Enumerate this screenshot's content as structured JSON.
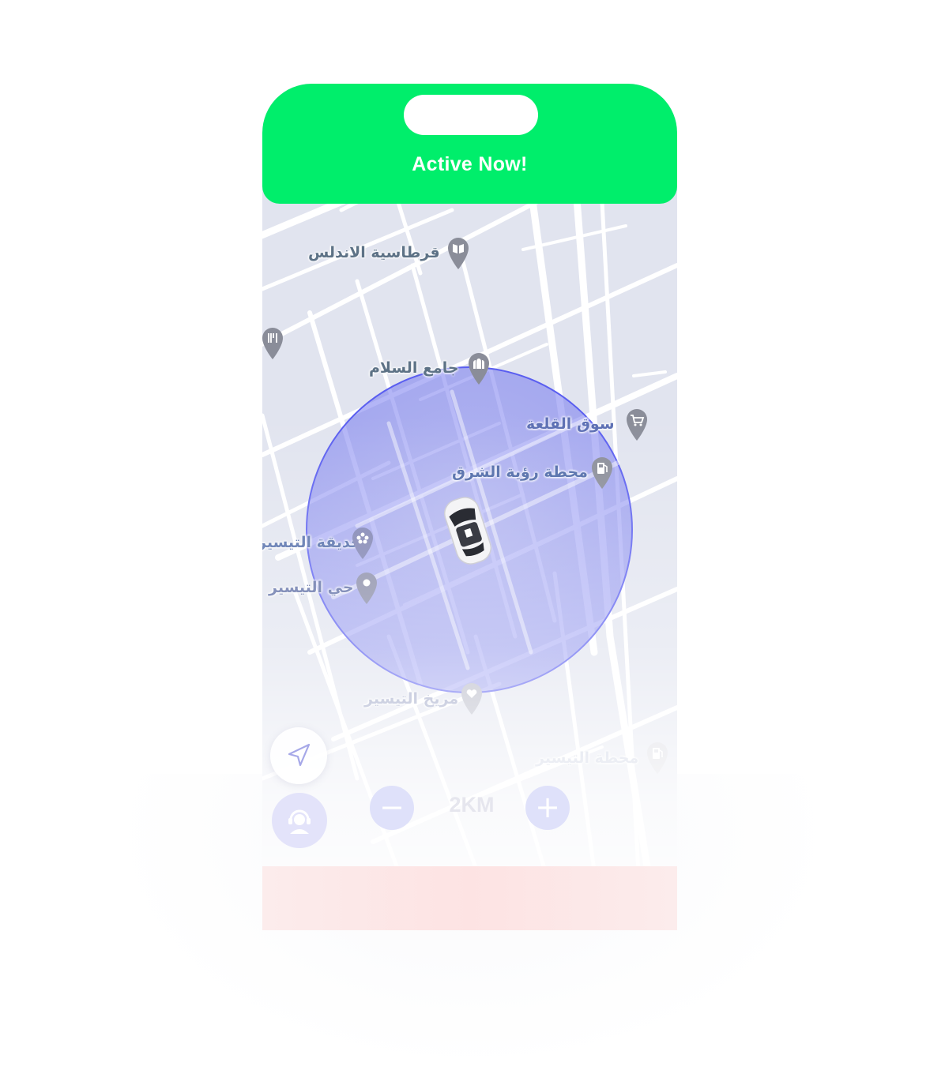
{
  "header": {
    "status": "Active Now!",
    "color": "#00ee6b"
  },
  "map": {
    "places": [
      {
        "name": "قرطاسية الاندلس",
        "icon": "book-pin-icon"
      },
      {
        "name": "جامع السلام",
        "icon": "mosque-pin-icon"
      },
      {
        "name": "سوق القلعة",
        "icon": "cart-pin-icon"
      },
      {
        "name": "محطة رؤية الشرق",
        "icon": "fuel-pin-icon"
      },
      {
        "name": "حديقة التيسير",
        "icon": "park-pin-icon"
      },
      {
        "name": "حي التيسير",
        "icon": "location-pin-icon"
      },
      {
        "name": "مريخ التيسير",
        "icon": "heart-pin-icon"
      },
      {
        "name": "محطة التيسير",
        "icon": "fuel-pin-icon"
      }
    ],
    "extra_icons": [
      "restaurant-pin-icon",
      "car-icon"
    ],
    "radius_color": "#5a5ef0"
  },
  "controls": {
    "zoom_value": "2KM",
    "minus_label": "−",
    "plus_label": "+",
    "locate_icon": "navigation-arrow-icon",
    "support_icon": "support-agent-icon"
  }
}
